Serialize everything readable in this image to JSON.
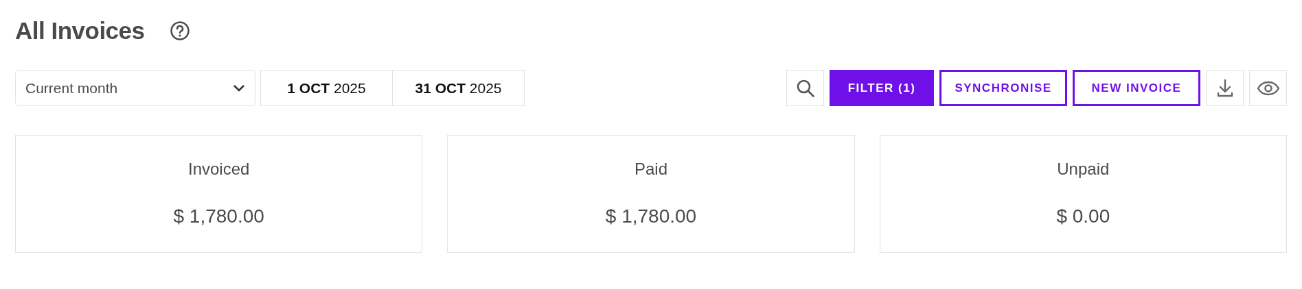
{
  "title": "All Invoices",
  "period_select": {
    "value": "Current month"
  },
  "date_range": [
    "**1 OCT** 2025",
    "**31 OCT** 2025"
  ],
  "actions": [
    {
      "kind": "search"
    },
    {
      "kind": "primary",
      "label": "FILTER (1)"
    },
    {
      "kind": "outline",
      "label": "SYNCHRONISE"
    },
    {
      "kind": "outline",
      "label": "NEW INVOICE"
    },
    {
      "kind": "download"
    },
    {
      "kind": "view"
    }
  ],
  "summary_cards": [
    {
      "label": "Invoiced",
      "amount": "$ 1,780.00"
    },
    {
      "label": "Paid",
      "amount": "$ 1,780.00"
    },
    {
      "label": "Unpaid",
      "amount": "$ 0.00"
    }
  ]
}
